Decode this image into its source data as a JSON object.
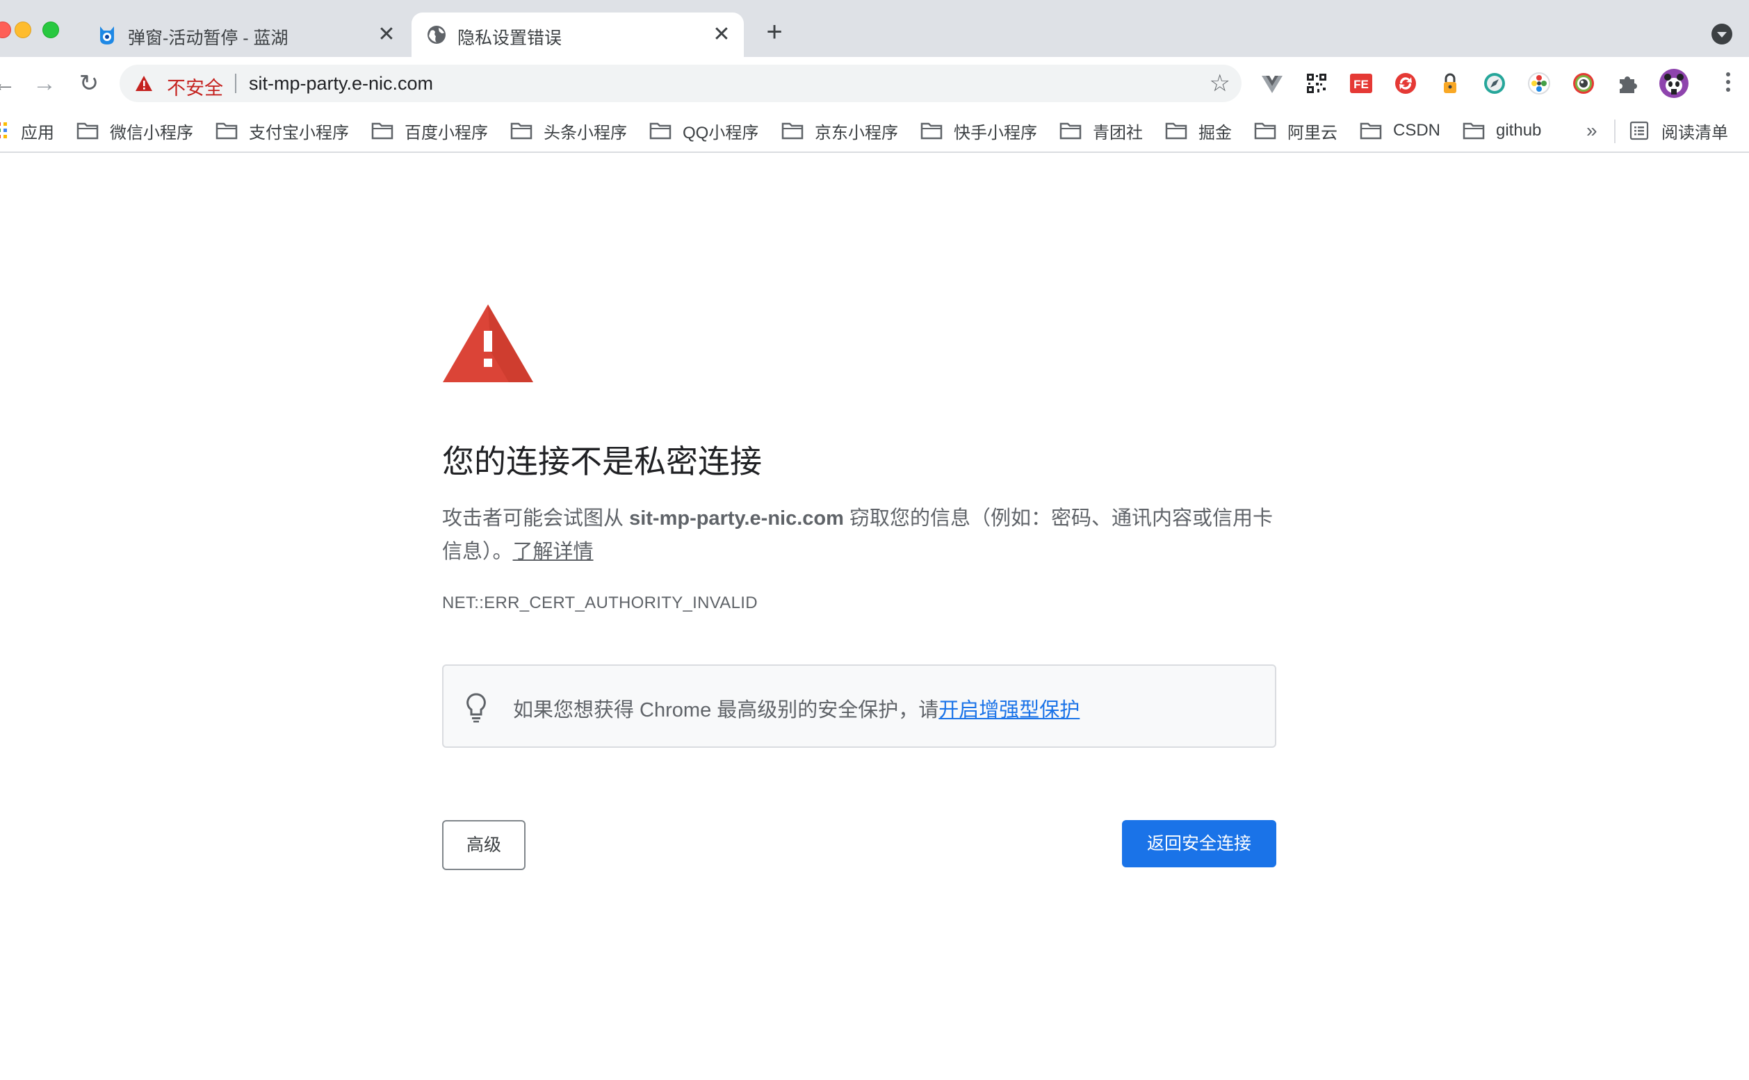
{
  "window": {
    "traffic_lights": [
      "close",
      "minimize",
      "zoom"
    ]
  },
  "tabs": [
    {
      "title": "弹窗-活动暂停 - 蓝湖",
      "close_label": "✕",
      "active": false
    },
    {
      "title": "隐私设置错误",
      "close_label": "✕",
      "active": true
    }
  ],
  "new_tab_label": "+",
  "toolbar": {
    "back_label": "←",
    "forward_label": "→",
    "reload_label": "↻",
    "security_label": "不安全",
    "url": "sit-mp-party.e-nic.com",
    "bookmark_star": "☆"
  },
  "extensions": [
    "vue-devtools-icon",
    "qr-code-icon",
    "fe-helper-icon",
    "sync-icon",
    "lock-icon",
    "compass-icon",
    "color-picker-icon",
    "camera-icon",
    "puzzle-icon",
    "avatar"
  ],
  "bookmarks": {
    "apps_label": "应用",
    "items": [
      "微信小程序",
      "支付宝小程序",
      "百度小程序",
      "头条小程序",
      "QQ小程序",
      "京东小程序",
      "快手小程序",
      "青团社",
      "掘金",
      "阿里云",
      "CSDN",
      "github"
    ],
    "more_label": "»",
    "reading_list_label": "阅读清单"
  },
  "interstitial": {
    "heading": "您的连接不是私密连接",
    "desc_prefix": "攻击者可能会试图从 ",
    "desc_host": "sit-mp-party.e-nic.com",
    "desc_suffix": " 窃取您的信息（例如：密码、通讯内容或信用卡信息）。",
    "learn_more": "了解详情",
    "error_code": "NET::ERR_CERT_AUTHORITY_INVALID",
    "enhanced_text": "如果您想获得 Chrome 最高级别的安全保护，请",
    "enhanced_link": "开启增强型保护",
    "advanced_button": "高级",
    "back_button": "返回安全连接"
  },
  "colors": {
    "danger": "#d93025",
    "primary": "#1a73e8",
    "tabstrip": "#dee1e6"
  }
}
